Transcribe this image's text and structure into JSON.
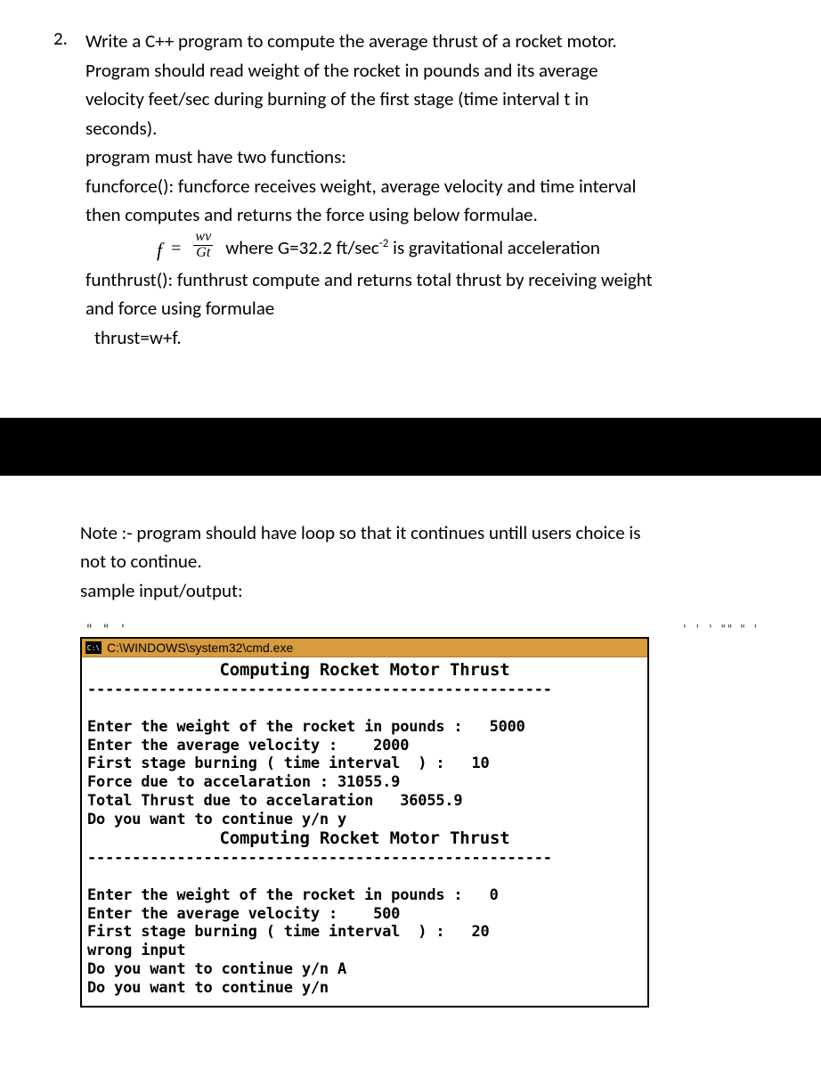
{
  "question": {
    "number": "2.",
    "lines": {
      "l1": "Write a C++ program to compute the average thrust of a rocket motor.",
      "l2": "Program should read weight of the rocket in pounds and its average",
      "l3": "velocity feet/sec during burning of the first stage (time interval t in",
      "l4": "seconds).",
      "l5": "program must have two functions:",
      "l6": "funcforce(): funcforce receives weight, average velocity and time interval",
      "l7": "then computes and returns the force using below formulae."
    },
    "formula": {
      "var": "f",
      "eq": "=",
      "num": "wv",
      "den": "Gt",
      "desc_pre": "where G=32.2 ft/sec",
      "desc_sup": "-2",
      "desc_post": " is gravitational acceleration"
    },
    "after_formula": {
      "l1": "funthrust(): funthrust compute and returns total thrust by receiving weight",
      "l2": "and force  using formulae",
      "l3": "thrust=w+f."
    }
  },
  "note": {
    "l1": "Note :-  program should have loop so that it continues untill users choice is",
    "l2": "not to continue.",
    "l3": "sample input/output:"
  },
  "terminal": {
    "partial_top": "\" \" '",
    "partial_right": "' ' ' \"\"  \" '",
    "title": "C:\\WINDOWS\\system32\\cmd.exe",
    "header1": "Computing Rocket Motor Thrust",
    "dashes": "----------------------------------------------------",
    "run1": {
      "l1": "Enter the weight of the rocket in pounds :   5000",
      "l2": "Enter the average velocity :    2000",
      "l3": "First stage burning ( time interval  ) :   10",
      "l4": "Force due to accelaration : 31055.9",
      "l5": "Total Thrust due to accelaration   36055.9",
      "l6": "Do you want to continue y/n y"
    },
    "header2": "Computing Rocket Motor Thrust",
    "run2": {
      "l1": "Enter the weight of the rocket in pounds :   0",
      "l2": "Enter the average velocity :    500",
      "l3": "First stage burning ( time interval  ) :   20",
      "l4": "wrong input",
      "l5": "Do you want to continue y/n A",
      "l6": "Do you want to continue y/n"
    }
  }
}
